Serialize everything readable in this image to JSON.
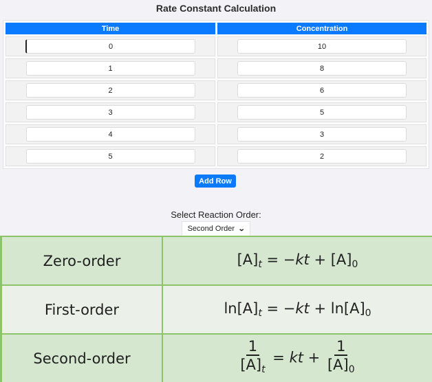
{
  "title": "Rate Constant Calculation",
  "table": {
    "headers": [
      "Time",
      "Concentration"
    ],
    "rows": [
      {
        "time": "0",
        "concentration": "10"
      },
      {
        "time": "1",
        "concentration": "8"
      },
      {
        "time": "2",
        "concentration": "6"
      },
      {
        "time": "3",
        "concentration": "5"
      },
      {
        "time": "4",
        "concentration": "3"
      },
      {
        "time": "5",
        "concentration": "2"
      }
    ]
  },
  "add_row_label": "Add Row",
  "reaction_order": {
    "label": "Select Reaction Order:",
    "selected": "Second Order"
  },
  "equations": [
    {
      "name": "Zero-order",
      "equation": "[A]t = −kt + [A]0"
    },
    {
      "name": "First-order",
      "equation": "ln[A]t = −kt + ln[A]0"
    },
    {
      "name": "Second-order",
      "equation": "1/[A]t = kt + 1/[A]0"
    }
  ],
  "colors": {
    "accent": "#0a7bff",
    "equation_border": "#8cc46a",
    "equation_row_dark": "#d6e7d0",
    "equation_row_light": "#ebf1e8"
  }
}
